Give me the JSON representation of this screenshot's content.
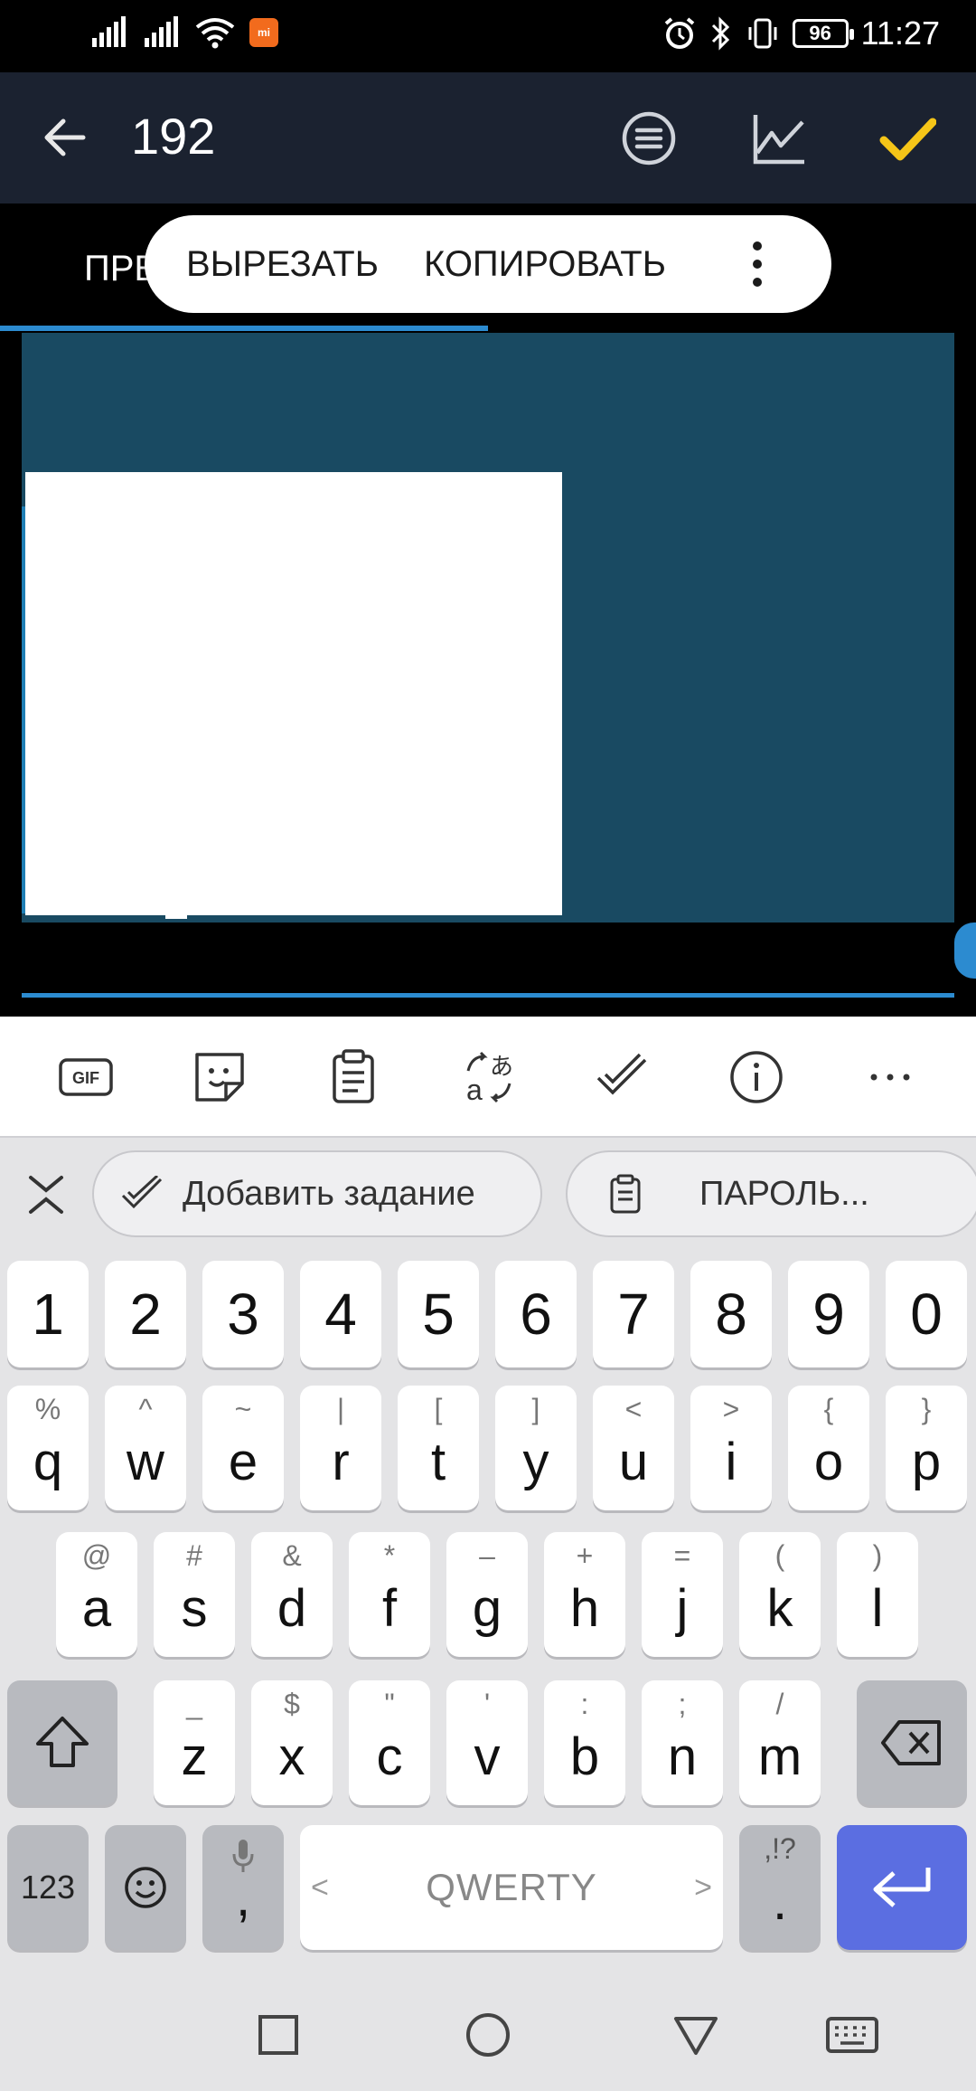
{
  "status_bar": {
    "time": "11:27",
    "battery": "96",
    "icons": [
      "signal-icon",
      "signal-icon",
      "wifi-icon",
      "mi-icon",
      "alarm-icon",
      "bluetooth-icon",
      "vibrate-icon",
      "battery-icon"
    ]
  },
  "app_bar": {
    "title": "192",
    "icons": [
      "back-arrow-icon",
      "list-menu-icon",
      "chart-icon",
      "check-icon"
    ],
    "check_color": "#f5c518"
  },
  "tab": {
    "visible_label": "ПРЕ"
  },
  "context_menu": {
    "items": [
      "ВЫРЕЗАТЬ",
      "КОПИРОВАТЬ"
    ],
    "more_icon": "more-vertical-icon"
  },
  "editor": {
    "background": "#194a62",
    "selection_color": "#ffffff"
  },
  "keyboard": {
    "toolbar_icons": [
      "gif-icon",
      "sticker-icon",
      "clipboard-icon",
      "translate-icon",
      "task-check-icon",
      "info-icon",
      "more-horizontal-icon"
    ],
    "gif_label": "GIF",
    "suggestions": [
      {
        "icon": "task-check-icon",
        "label": "Добавить задание"
      },
      {
        "icon": "clipboard-icon",
        "label": "ПАРОЛЬ..."
      }
    ],
    "number_row": [
      "1",
      "2",
      "3",
      "4",
      "5",
      "6",
      "7",
      "8",
      "9",
      "0"
    ],
    "row1": [
      {
        "main": "q",
        "sub": "%"
      },
      {
        "main": "w",
        "sub": "^"
      },
      {
        "main": "e",
        "sub": "~"
      },
      {
        "main": "r",
        "sub": "|"
      },
      {
        "main": "t",
        "sub": "["
      },
      {
        "main": "y",
        "sub": "]"
      },
      {
        "main": "u",
        "sub": "<"
      },
      {
        "main": "i",
        "sub": ">"
      },
      {
        "main": "o",
        "sub": "{"
      },
      {
        "main": "p",
        "sub": "}"
      }
    ],
    "row2": [
      {
        "main": "a",
        "sub": "@"
      },
      {
        "main": "s",
        "sub": "#"
      },
      {
        "main": "d",
        "sub": "&"
      },
      {
        "main": "f",
        "sub": "*"
      },
      {
        "main": "g",
        "sub": "–"
      },
      {
        "main": "h",
        "sub": "+"
      },
      {
        "main": "j",
        "sub": "="
      },
      {
        "main": "k",
        "sub": "("
      },
      {
        "main": "l",
        "sub": ")"
      }
    ],
    "row3": [
      {
        "main": "z",
        "sub": "_"
      },
      {
        "main": "x",
        "sub": "$"
      },
      {
        "main": "c",
        "sub": "\""
      },
      {
        "main": "v",
        "sub": "'"
      },
      {
        "main": "b",
        "sub": ":"
      },
      {
        "main": "n",
        "sub": ";"
      },
      {
        "main": "m",
        "sub": "/"
      }
    ],
    "bottom": {
      "numbers_label": "123",
      "comma": ",",
      "space_label": "QWERTY",
      "space_left": "<",
      "space_right": ">",
      "period": ".",
      "period_sub": ",!?"
    },
    "enter_color": "#5b6ee1"
  },
  "nav_bar": {
    "icons": [
      "recents-square-icon",
      "home-circle-icon",
      "back-triangle-icon",
      "keyboard-icon"
    ]
  }
}
